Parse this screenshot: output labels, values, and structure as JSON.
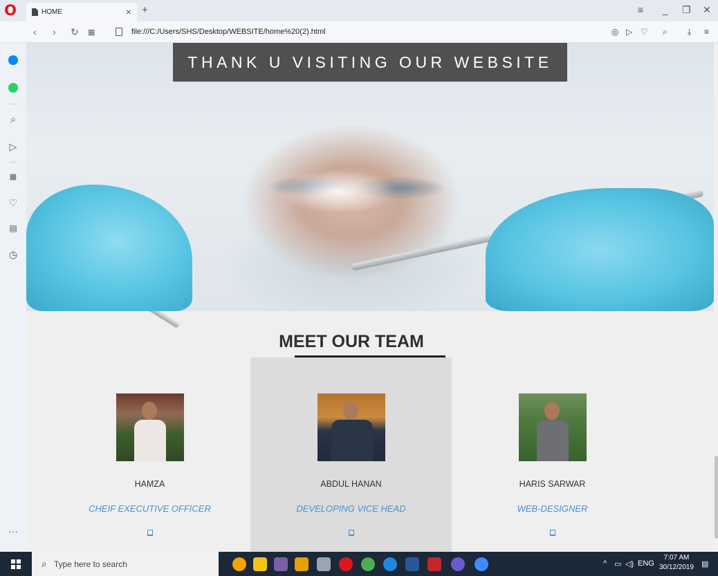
{
  "browser": {
    "tab_title": "HOME",
    "tab_close": "×",
    "new_tab": "+",
    "url": "file:///C:/Users/SHS/Desktop/WEBSITE/home%20(2).html"
  },
  "banner": {
    "text": "THANK U VISITING OUR WEBSITE"
  },
  "team": {
    "title": "MEET OUR TEAM",
    "members": [
      {
        "name": "HAMZA",
        "role": "CHEIF EXECUTIVE OFFICER"
      },
      {
        "name": "ABDUL HANAN",
        "role": "DEVELOPING VICE HEAD"
      },
      {
        "name": "HARIS SARWAR",
        "role": "WEB-DESIGNER"
      }
    ]
  },
  "taskbar": {
    "search_placeholder": "Type here to search",
    "lang": "ENG",
    "time": "7:07 AM",
    "date": "30/12/2019"
  },
  "colors": {
    "banner_bg": "#505050",
    "role_text": "#4a90d9",
    "glove": "#55c4e2",
    "taskbar": "#1b2838"
  },
  "icons": [
    "opera-logo-icon",
    "messenger-icon",
    "whatsapp-icon",
    "search-icon",
    "send-icon",
    "speed-dial-icon",
    "heart-icon",
    "news-icon",
    "history-icon",
    "more-icon"
  ]
}
